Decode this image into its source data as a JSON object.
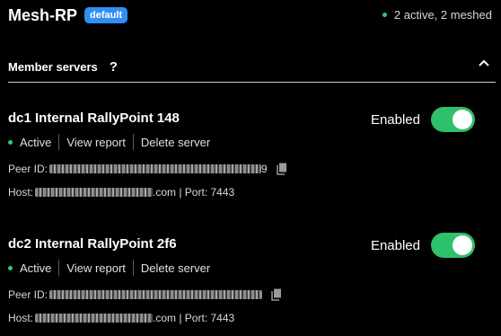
{
  "mesh": {
    "name": "Mesh-RP",
    "badge": "default",
    "status": "2 active, 2 meshed",
    "status_color": "#2ecc71"
  },
  "section": {
    "title": "Member servers",
    "help_icon": "?",
    "collapse_icon": "chevron-up-icon"
  },
  "servers": [
    {
      "name": "dc1 Internal RallyPoint 148",
      "enabled_label": "Enabled",
      "enabled": true,
      "status": "Active",
      "view_report": "View report",
      "delete": "Delete server",
      "peer_label": "Peer ID:",
      "peer_tail": "9",
      "host_label": "Host:",
      "host_tail": ".com | Port: 7443"
    },
    {
      "name": "dc2 Internal RallyPoint 2f6",
      "enabled_label": "Enabled",
      "enabled": true,
      "status": "Active",
      "view_report": "View report",
      "delete": "Delete server",
      "peer_label": "Peer ID:",
      "peer_tail": "",
      "host_label": "Host:",
      "host_tail": ".com | Port: 7443"
    }
  ],
  "colors": {
    "accent": "#2f8ff2",
    "toggle_on": "#2ec06a",
    "status_active": "#2ecc71",
    "background": "#000000"
  }
}
